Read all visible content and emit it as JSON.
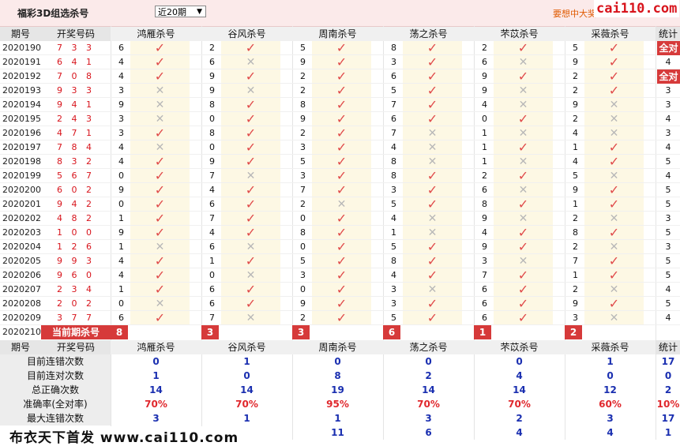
{
  "header": {
    "title": "福彩3D组选杀号",
    "select_value": "近20期",
    "promo": "要想中大奖",
    "brand": "cai110.com"
  },
  "columns": {
    "period": "期号",
    "draw": "开奖号码",
    "experts": [
      "鸿雁杀号",
      "谷风杀号",
      "周南杀号",
      "荡之杀号",
      "芣苡杀号",
      "采薇杀号"
    ],
    "stat": "统计"
  },
  "rows": [
    {
      "period": "2020190",
      "draw": "7 3 3",
      "kills": [
        6,
        2,
        5,
        8,
        2,
        5
      ],
      "marks": [
        1,
        1,
        1,
        1,
        1,
        1
      ],
      "stat": "全对"
    },
    {
      "period": "2020191",
      "draw": "6 4 1",
      "kills": [
        4,
        6,
        9,
        3,
        6,
        9
      ],
      "marks": [
        1,
        0,
        1,
        1,
        0,
        1
      ],
      "stat": "4"
    },
    {
      "period": "2020192",
      "draw": "7 0 8",
      "kills": [
        4,
        9,
        2,
        6,
        9,
        2
      ],
      "marks": [
        1,
        1,
        1,
        1,
        1,
        1
      ],
      "stat": "全对"
    },
    {
      "period": "2020193",
      "draw": "9 3 3",
      "kills": [
        3,
        9,
        2,
        5,
        9,
        2
      ],
      "marks": [
        0,
        0,
        1,
        1,
        0,
        1
      ],
      "stat": "3"
    },
    {
      "period": "2020194",
      "draw": "9 4 1",
      "kills": [
        9,
        8,
        8,
        7,
        4,
        9
      ],
      "marks": [
        0,
        1,
        1,
        1,
        0,
        0
      ],
      "stat": "3"
    },
    {
      "period": "2020195",
      "draw": "2 4 3",
      "kills": [
        3,
        0,
        9,
        6,
        0,
        2
      ],
      "marks": [
        0,
        1,
        1,
        1,
        1,
        0
      ],
      "stat": "4"
    },
    {
      "period": "2020196",
      "draw": "4 7 1",
      "kills": [
        3,
        8,
        2,
        7,
        1,
        4
      ],
      "marks": [
        1,
        1,
        1,
        0,
        0,
        0
      ],
      "stat": "3"
    },
    {
      "period": "2020197",
      "draw": "7 8 4",
      "kills": [
        4,
        0,
        3,
        4,
        1,
        1
      ],
      "marks": [
        0,
        1,
        1,
        0,
        1,
        1
      ],
      "stat": "4"
    },
    {
      "period": "2020198",
      "draw": "8 3 2",
      "kills": [
        4,
        9,
        5,
        8,
        1,
        4
      ],
      "marks": [
        1,
        1,
        1,
        0,
        0,
        1
      ],
      "stat": "5"
    },
    {
      "period": "2020199",
      "draw": "5 6 7",
      "kills": [
        0,
        7,
        3,
        8,
        2,
        5
      ],
      "marks": [
        1,
        0,
        1,
        1,
        1,
        0
      ],
      "stat": "4"
    },
    {
      "period": "2020200",
      "draw": "6 0 2",
      "kills": [
        9,
        4,
        7,
        3,
        6,
        9
      ],
      "marks": [
        1,
        1,
        1,
        1,
        0,
        1
      ],
      "stat": "5"
    },
    {
      "period": "2020201",
      "draw": "9 4 2",
      "kills": [
        0,
        6,
        2,
        5,
        8,
        1
      ],
      "marks": [
        1,
        1,
        0,
        1,
        1,
        1
      ],
      "stat": "5"
    },
    {
      "period": "2020202",
      "draw": "4 8 2",
      "kills": [
        1,
        7,
        0,
        4,
        9,
        2
      ],
      "marks": [
        1,
        1,
        1,
        0,
        0,
        0
      ],
      "stat": "3"
    },
    {
      "period": "2020203",
      "draw": "1 0 0",
      "kills": [
        9,
        4,
        8,
        1,
        4,
        8
      ],
      "marks": [
        1,
        1,
        1,
        0,
        1,
        1
      ],
      "stat": "5"
    },
    {
      "period": "2020204",
      "draw": "1 2 6",
      "kills": [
        1,
        6,
        0,
        5,
        9,
        2
      ],
      "marks": [
        0,
        0,
        1,
        1,
        1,
        0
      ],
      "stat": "3"
    },
    {
      "period": "2020205",
      "draw": "9 9 3",
      "kills": [
        4,
        1,
        5,
        8,
        3,
        7
      ],
      "marks": [
        1,
        1,
        1,
        1,
        0,
        1
      ],
      "stat": "5"
    },
    {
      "period": "2020206",
      "draw": "9 6 0",
      "kills": [
        4,
        0,
        3,
        4,
        7,
        1
      ],
      "marks": [
        1,
        0,
        1,
        1,
        1,
        1
      ],
      "stat": "5"
    },
    {
      "period": "2020207",
      "draw": "2 3 4",
      "kills": [
        1,
        6,
        0,
        3,
        6,
        2
      ],
      "marks": [
        1,
        1,
        1,
        0,
        1,
        0
      ],
      "stat": "4"
    },
    {
      "period": "2020208",
      "draw": "2 0 2",
      "kills": [
        0,
        6,
        9,
        3,
        6,
        9
      ],
      "marks": [
        0,
        1,
        1,
        1,
        1,
        1
      ],
      "stat": "5"
    },
    {
      "period": "2020209",
      "draw": "3 7 7",
      "kills": [
        6,
        7,
        2,
        5,
        6,
        3
      ],
      "marks": [
        1,
        0,
        1,
        1,
        1,
        0
      ],
      "stat": "4"
    }
  ],
  "current": {
    "period": "2020210",
    "label": "当前期杀号",
    "kills": [
      "8",
      "3",
      "3",
      "6",
      "1",
      "2"
    ]
  },
  "footer_header": {
    "period": "期号",
    "draw": "开奖号码",
    "experts": [
      "鸿雁杀号",
      "谷风杀号",
      "周南杀号",
      "荡之杀号",
      "芣苡杀号",
      "采薇杀号"
    ],
    "stat": "统计"
  },
  "stats": [
    {
      "label": "目前连错次数",
      "values": [
        "0",
        "1",
        "0",
        "0",
        "0",
        "1"
      ],
      "stat": "17",
      "red": false
    },
    {
      "label": "目前连对次数",
      "values": [
        "1",
        "0",
        "8",
        "2",
        "4",
        "0"
      ],
      "stat": "0",
      "red": false
    },
    {
      "label": "总正确次数",
      "values": [
        "14",
        "14",
        "19",
        "14",
        "14",
        "12"
      ],
      "stat": "2",
      "red": false
    },
    {
      "label": "准确率(全对率)",
      "values": [
        "70%",
        "70%",
        "95%",
        "70%",
        "70%",
        "60%"
      ],
      "stat": "10%",
      "red": true
    },
    {
      "label": "最大连错次数",
      "values": [
        "3",
        "1",
        "1",
        "3",
        "2",
        "3"
      ],
      "stat": "17",
      "red": false
    },
    {
      "label": "",
      "values": [
        "",
        "",
        "11",
        "6",
        "4",
        "4"
      ],
      "stat": "1",
      "red": false
    }
  ],
  "watermark": "布衣天下首发 www.cai110.com",
  "colors": {
    "accent": "#d63a3a",
    "ok": "#e04a4a",
    "blue": "#1a2fb0"
  }
}
